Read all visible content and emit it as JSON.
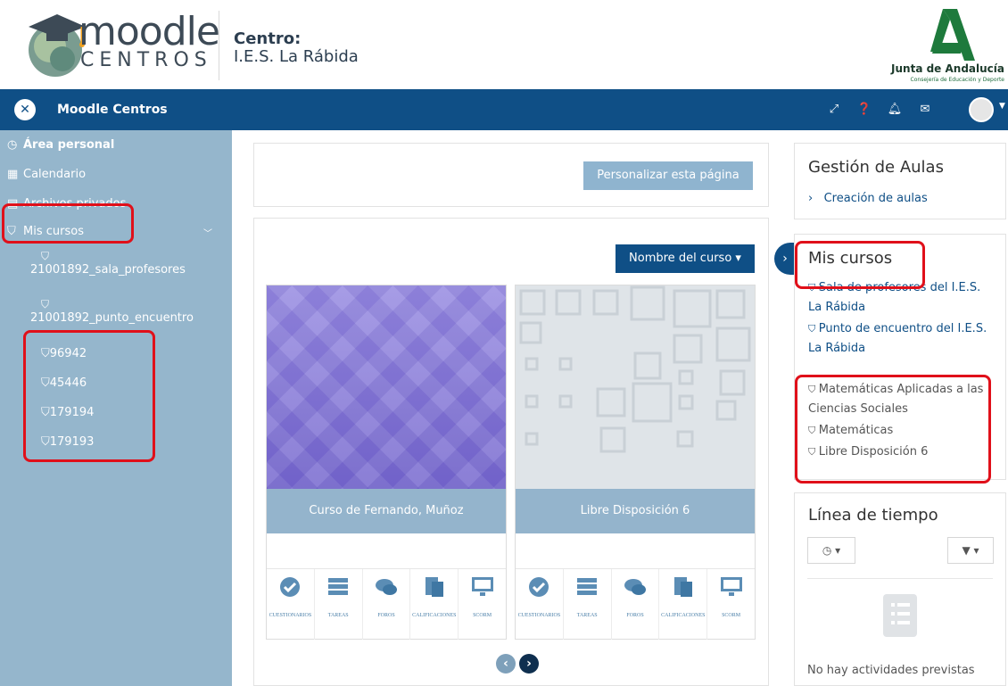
{
  "header": {
    "logo_word": "moodle",
    "logo_sub": "CENTROS",
    "centro_label": "Centro:",
    "centro_name": "I.E.S. La Rábida",
    "junta_name": "Junta de Andalucía",
    "junta_sub": "Consejería de Educación y Deporte"
  },
  "navbar": {
    "title": "Moodle Centros",
    "icons": [
      "expand-icon",
      "help-icon",
      "bell-icon",
      "mail-icon",
      "avatar-icon"
    ]
  },
  "sidebar": {
    "items": [
      {
        "icon": "dashboard-icon",
        "label": "Área personal"
      },
      {
        "icon": "calendar-icon",
        "label": "Calendario"
      },
      {
        "icon": "files-icon",
        "label": "Archivos privados"
      },
      {
        "icon": "graduation-cap-icon",
        "label": "Mis cursos"
      }
    ],
    "courses": [
      "21001892_sala_profesores",
      "21001892_punto_encuentro",
      "96942",
      "45446",
      "179194",
      "179193"
    ]
  },
  "main": {
    "customize_label": "Personalizar esta página",
    "sort_label": "Nombre del curso",
    "courses": [
      {
        "name": "Curso de Fernando, Muñoz",
        "pattern_color": "#8b7fd6",
        "tools": [
          "CUESTIONARIOS",
          "TAREAS",
          "FOROS",
          "CALIFICACIONES",
          "SCORM"
        ]
      },
      {
        "name": "Libre Disposición 6",
        "pattern_color": "#dfe4e8",
        "tools": [
          "CUESTIONARIOS",
          "TAREAS",
          "FOROS",
          "CALIFICACIONES",
          "SCORM"
        ]
      }
    ]
  },
  "right": {
    "aulas_title": "Gestión de Aulas",
    "aulas_link": "Creación de aulas",
    "mis_title": "Mis cursos",
    "mis_links": [
      "Sala de profesores del I.E.S. La Rábida",
      "Punto de encuentro del I.E.S. La Rábida"
    ],
    "mis_gray": [
      "Matemáticas Aplicadas a las Ciencias Sociales",
      "Matemáticas",
      "Libre Disposición 6"
    ],
    "linea_title": "Línea de tiempo",
    "empty_text": "No hay actividades previstas"
  },
  "colors": {
    "navbar": "#0f4f86",
    "sidebar": "#95b6cc",
    "accent": "#e0101a"
  }
}
